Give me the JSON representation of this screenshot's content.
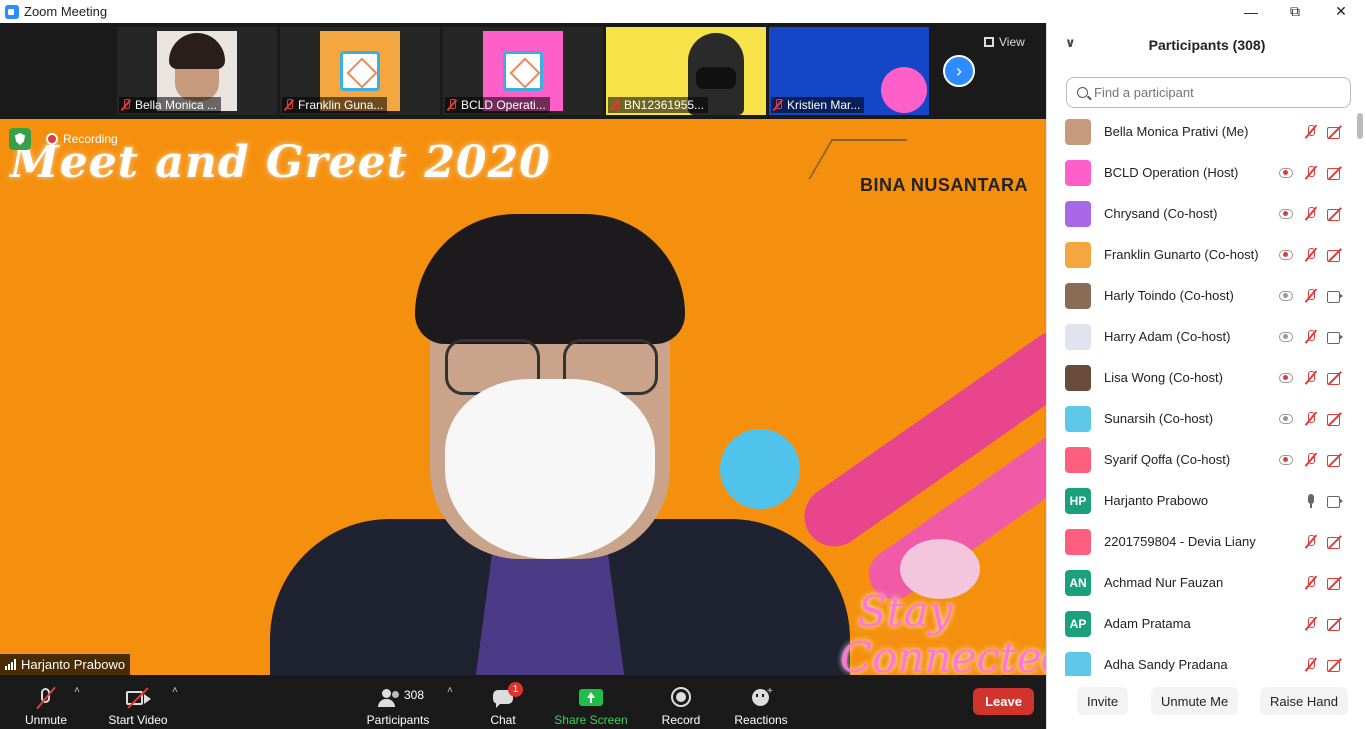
{
  "window": {
    "title": "Zoom Meeting",
    "minimize": "—",
    "maximize": "⧉",
    "close": "✕"
  },
  "gallery": {
    "thumbs": [
      {
        "name": "Bella Monica ..."
      },
      {
        "name": "Franklin Guna..."
      },
      {
        "name": "BCLD Operati..."
      },
      {
        "name": "BN12361955..."
      },
      {
        "name": "Kristien Mar..."
      }
    ],
    "view_label": "View",
    "next_icon": "›"
  },
  "main": {
    "banner": "Meet and Greet 2020",
    "brand": "BINA NUSANTARA",
    "stay_line1": "Stay",
    "stay_line2": "Connected",
    "recording_label": "Recording",
    "speaker_name": "Harjanto Prabowo"
  },
  "toolbar": {
    "unmute": "Unmute",
    "start_video": "Start Video",
    "participants": "Participants",
    "participant_count": "308",
    "chat": "Chat",
    "chat_badge": "1",
    "share_screen": "Share Screen",
    "record": "Record",
    "reactions": "Reactions",
    "leave": "Leave",
    "caret": "˄"
  },
  "panel": {
    "title": "Participants (308)",
    "collapse_icon": "∨",
    "search_placeholder": "Find a participant",
    "participants": [
      {
        "name": "Bella Monica Prativi (Me)",
        "avatar": "",
        "color": "#c79a7e",
        "rec": "",
        "mic": "off",
        "cam": "off"
      },
      {
        "name": "BCLD Operation (Host)",
        "avatar": "",
        "color": "#ff5fc8",
        "rec": "red",
        "mic": "off",
        "cam": "off"
      },
      {
        "name": "Chrysand (Co-host)",
        "avatar": "",
        "color": "#a767e6",
        "rec": "red",
        "mic": "off",
        "cam": "off"
      },
      {
        "name": "Franklin Gunarto (Co-host)",
        "avatar": "",
        "color": "#f4a640",
        "rec": "red",
        "mic": "off",
        "cam": "off"
      },
      {
        "name": "Harly Toindo (Co-host)",
        "avatar": "",
        "color": "#8a6b55",
        "rec": "grey",
        "mic": "off",
        "cam": "on"
      },
      {
        "name": "Harry Adam (Co-host)",
        "avatar": "",
        "color": "#dfe4ef",
        "rec": "grey",
        "mic": "off",
        "cam": "on"
      },
      {
        "name": "Lisa Wong (Co-host)",
        "avatar": "",
        "color": "#6a4a3a",
        "rec": "red",
        "mic": "off",
        "cam": "off"
      },
      {
        "name": "Sunarsih (Co-host)",
        "avatar": "",
        "color": "#5fc7e8",
        "rec": "grey",
        "mic": "off",
        "cam": "off"
      },
      {
        "name": "Syarif Qoffa (Co-host)",
        "avatar": "",
        "color": "#ff5f7e",
        "rec": "red",
        "mic": "off",
        "cam": "off"
      },
      {
        "name": "Harjanto Prabowo",
        "avatar": "HP",
        "color": "#1aa17b",
        "rec": "",
        "mic": "on",
        "cam": "on"
      },
      {
        "name": "2201759804 - Devia Liany",
        "avatar": "",
        "color": "#ff5f7e",
        "rec": "",
        "mic": "off",
        "cam": "off"
      },
      {
        "name": "Achmad Nur Fauzan",
        "avatar": "AN",
        "color": "#1aa17b",
        "rec": "",
        "mic": "off",
        "cam": "off"
      },
      {
        "name": "Adam Pratama",
        "avatar": "AP",
        "color": "#1aa17b",
        "rec": "",
        "mic": "off",
        "cam": "off"
      },
      {
        "name": "Adha Sandy Pradana",
        "avatar": "",
        "color": "#5fc7e8",
        "rec": "",
        "mic": "off",
        "cam": "off"
      }
    ],
    "invite": "Invite",
    "unmute_me": "Unmute Me",
    "raise_hand": "Raise Hand"
  }
}
